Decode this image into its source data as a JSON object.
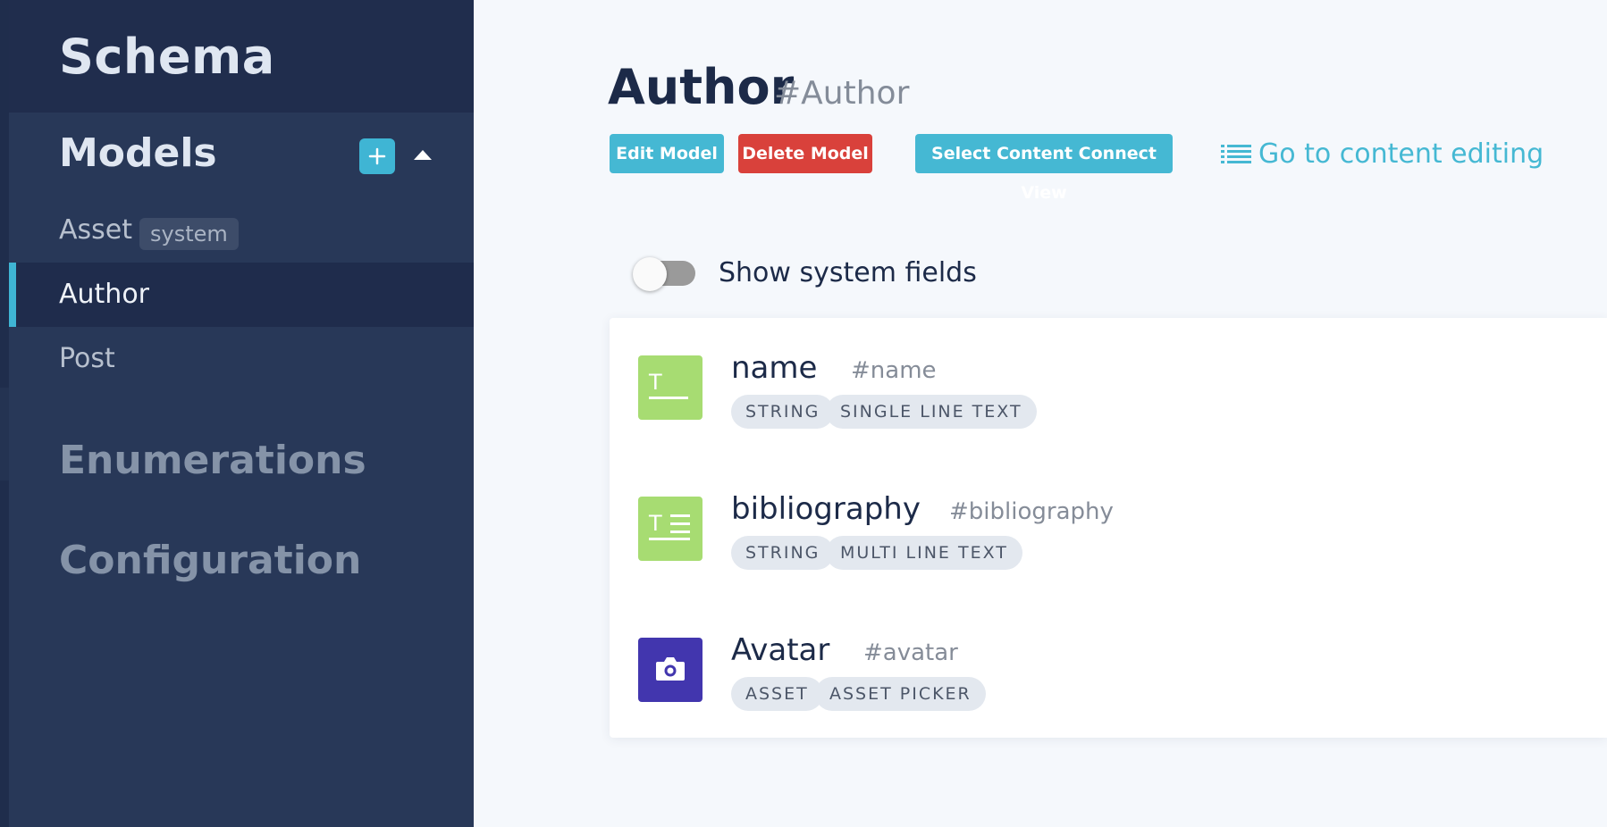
{
  "sidebar": {
    "schema_title": "Schema",
    "models_title": "Models",
    "models": [
      {
        "label": "Asset",
        "badge": "system"
      },
      {
        "label": "Author"
      },
      {
        "label": "Post"
      }
    ],
    "enumerations_title": "Enumerations",
    "configuration_title": "Configuration",
    "add_icon": "plus-icon",
    "collapse_icon": "caret-up-icon"
  },
  "main": {
    "title": "Author",
    "api_id": "#Author",
    "buttons": {
      "edit": "Edit Model",
      "delete": "Delete Model",
      "connect": "Select Content Connect View"
    },
    "content_link": {
      "label": "Go to content editing",
      "icon": "list-icon"
    },
    "toggle": {
      "label": "Show system fields",
      "checked": false
    },
    "fields": [
      {
        "name": "name",
        "api_id": "#name",
        "icon": "single-line-text-icon",
        "tags": [
          "STRING",
          "SINGLE LINE TEXT"
        ]
      },
      {
        "name": "bibliography",
        "api_id": "#bibliography",
        "icon": "multi-line-text-icon",
        "tags": [
          "STRING",
          "MULTI LINE TEXT"
        ]
      },
      {
        "name": "Avatar",
        "api_id": "#avatar",
        "icon": "camera-icon",
        "tags": [
          "ASSET",
          "ASSET PICKER"
        ]
      }
    ]
  },
  "colors": {
    "sidebar_bg": "#283858",
    "accent": "#45b8d3",
    "danger": "#d9413b",
    "string_field": "#a7dc72",
    "asset_field": "#4236ae"
  }
}
